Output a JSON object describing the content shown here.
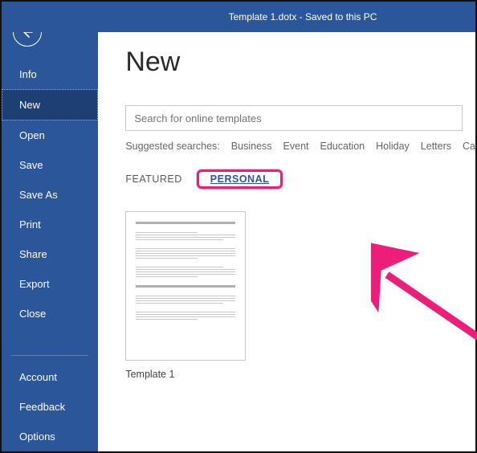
{
  "header": {
    "title": "Template 1.dotx  -  Saved to this PC"
  },
  "sidebar": {
    "items": [
      {
        "label": "Info"
      },
      {
        "label": "New"
      },
      {
        "label": "Open"
      },
      {
        "label": "Save"
      },
      {
        "label": "Save As"
      },
      {
        "label": "Print"
      },
      {
        "label": "Share"
      },
      {
        "label": "Export"
      },
      {
        "label": "Close"
      }
    ],
    "footer": [
      {
        "label": "Account"
      },
      {
        "label": "Feedback"
      },
      {
        "label": "Options"
      }
    ]
  },
  "main": {
    "title": "New",
    "search_placeholder": "Search for online templates",
    "suggested_label": "Suggested searches:",
    "suggested": [
      "Business",
      "Event",
      "Education",
      "Holiday",
      "Letters",
      "Ca"
    ],
    "tabs": {
      "featured": "FEATURED",
      "personal": "PERSONAL"
    },
    "templates": [
      {
        "name": "Template 1"
      }
    ]
  }
}
